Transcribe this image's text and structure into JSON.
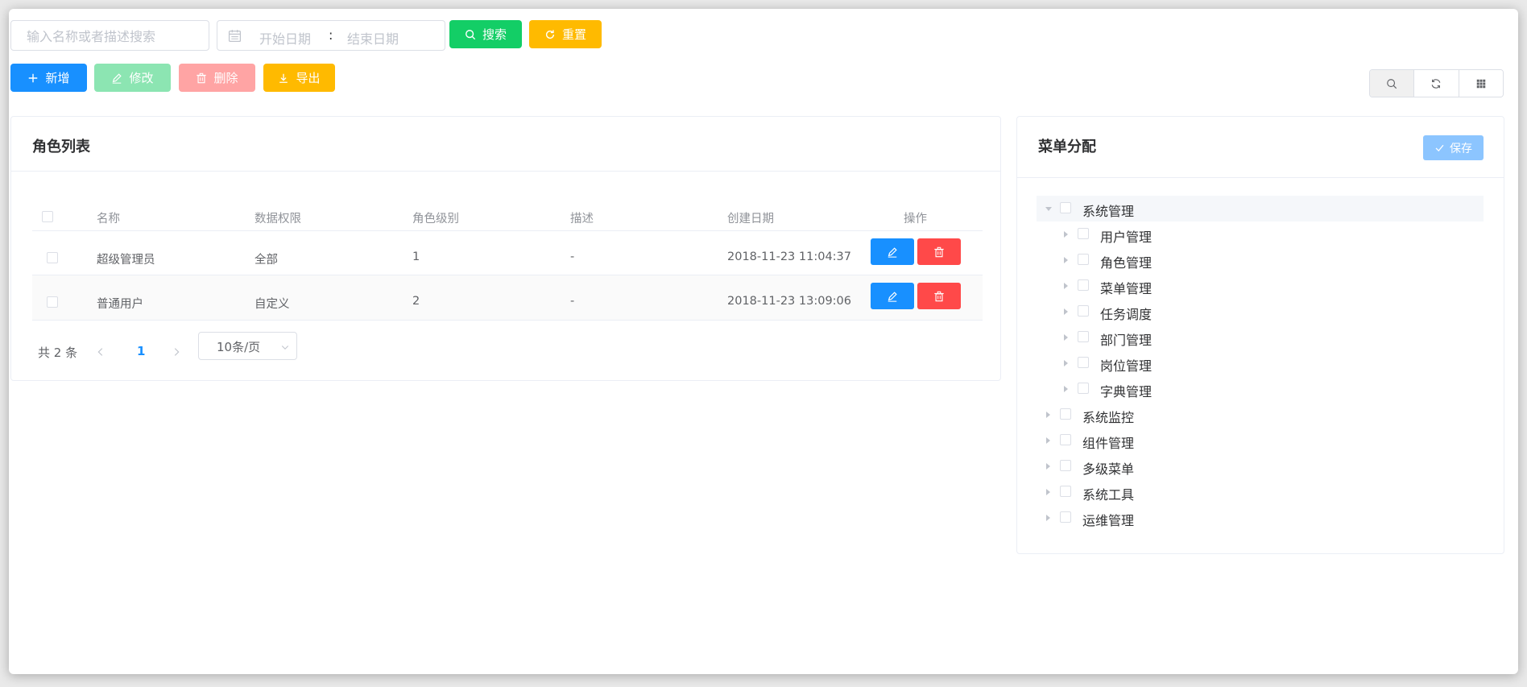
{
  "filters": {
    "search_placeholder": "输入名称或者描述搜索",
    "date_start_placeholder": "开始日期",
    "date_separator": ":",
    "date_end_placeholder": "结束日期",
    "search_button": "搜索",
    "reset_button": "重置"
  },
  "toolbar": {
    "add": "新增",
    "edit": "修改",
    "delete": "删除",
    "export": "导出"
  },
  "roles_panel": {
    "title": "角色列表",
    "columns": [
      "名称",
      "数据权限",
      "角色级别",
      "描述",
      "创建日期",
      "操作"
    ],
    "rows": [
      {
        "name": "超级管理员",
        "data_scope": "全部",
        "level": "1",
        "description": "-",
        "created": "2018-11-23 11:04:37"
      },
      {
        "name": "普通用户",
        "data_scope": "自定义",
        "level": "2",
        "description": "-",
        "created": "2018-11-23 13:09:06"
      }
    ],
    "pagination": {
      "total_text": "共 2 条",
      "current_page": "1",
      "page_size": "10条/页"
    }
  },
  "menu_panel": {
    "title": "菜单分配",
    "save_button": "保存",
    "tree": [
      {
        "label": "系统管理",
        "expanded": true,
        "children": [
          "用户管理",
          "角色管理",
          "菜单管理",
          "任务调度",
          "部门管理",
          "岗位管理",
          "字典管理"
        ]
      },
      {
        "label": "系统监控"
      },
      {
        "label": "组件管理"
      },
      {
        "label": "多级菜单"
      },
      {
        "label": "系统工具"
      },
      {
        "label": "运维管理"
      }
    ]
  },
  "colors": {
    "primary": "#1890ff",
    "success": "#13ce66",
    "warning": "#ffba00",
    "danger": "#ff4949"
  }
}
